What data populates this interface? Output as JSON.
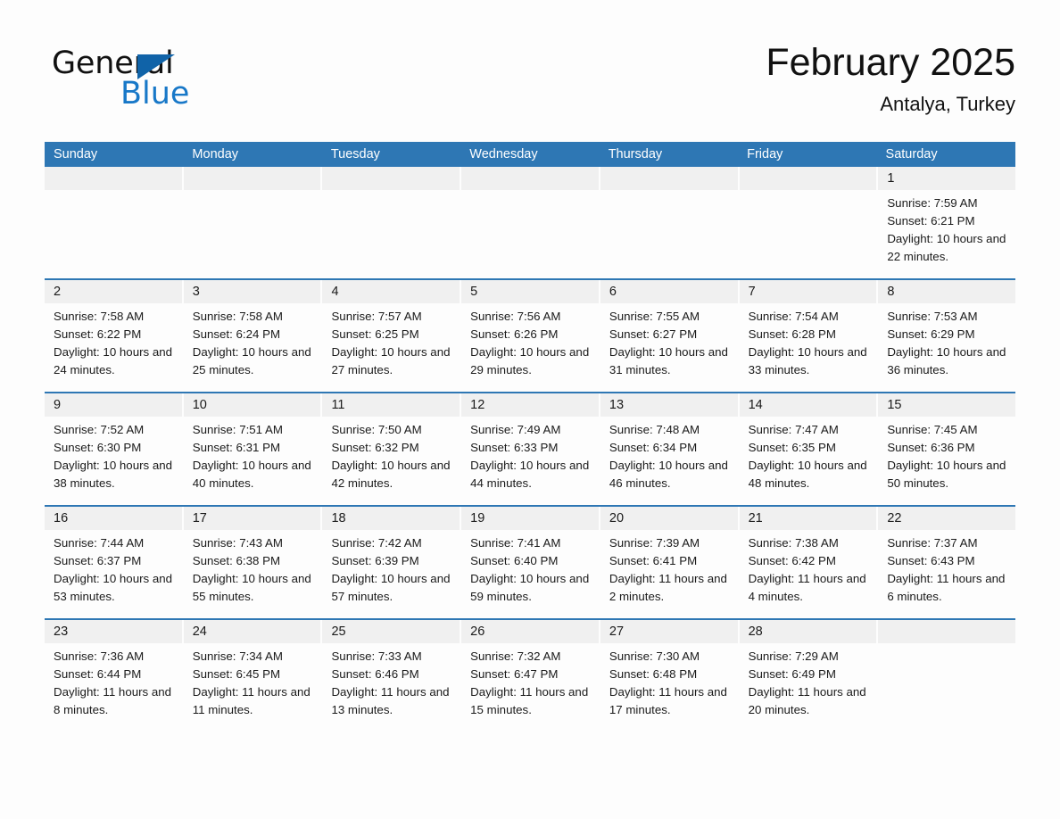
{
  "brand": {
    "name_primary": "General",
    "name_secondary": "Blue",
    "triangle_color": "#1063a8",
    "blue_color": "#1878c8"
  },
  "header": {
    "month_title": "February 2025",
    "location": "Antalya, Turkey"
  },
  "theme": {
    "header_blue": "#2e77b4",
    "day_band_gray": "#f0f0f0",
    "page_background": "#fdfdfd",
    "text_color": "#1a1a1a"
  },
  "calendar": {
    "weekdays": [
      "Sunday",
      "Monday",
      "Tuesday",
      "Wednesday",
      "Thursday",
      "Friday",
      "Saturday"
    ],
    "weeks": [
      [
        {
          "day": "",
          "sunrise": "",
          "sunset": "",
          "daylight": ""
        },
        {
          "day": "",
          "sunrise": "",
          "sunset": "",
          "daylight": ""
        },
        {
          "day": "",
          "sunrise": "",
          "sunset": "",
          "daylight": ""
        },
        {
          "day": "",
          "sunrise": "",
          "sunset": "",
          "daylight": ""
        },
        {
          "day": "",
          "sunrise": "",
          "sunset": "",
          "daylight": ""
        },
        {
          "day": "",
          "sunrise": "",
          "sunset": "",
          "daylight": ""
        },
        {
          "day": "1",
          "sunrise": "Sunrise: 7:59 AM",
          "sunset": "Sunset: 6:21 PM",
          "daylight": "Daylight: 10 hours and 22 minutes."
        }
      ],
      [
        {
          "day": "2",
          "sunrise": "Sunrise: 7:58 AM",
          "sunset": "Sunset: 6:22 PM",
          "daylight": "Daylight: 10 hours and 24 minutes."
        },
        {
          "day": "3",
          "sunrise": "Sunrise: 7:58 AM",
          "sunset": "Sunset: 6:24 PM",
          "daylight": "Daylight: 10 hours and 25 minutes."
        },
        {
          "day": "4",
          "sunrise": "Sunrise: 7:57 AM",
          "sunset": "Sunset: 6:25 PM",
          "daylight": "Daylight: 10 hours and 27 minutes."
        },
        {
          "day": "5",
          "sunrise": "Sunrise: 7:56 AM",
          "sunset": "Sunset: 6:26 PM",
          "daylight": "Daylight: 10 hours and 29 minutes."
        },
        {
          "day": "6",
          "sunrise": "Sunrise: 7:55 AM",
          "sunset": "Sunset: 6:27 PM",
          "daylight": "Daylight: 10 hours and 31 minutes."
        },
        {
          "day": "7",
          "sunrise": "Sunrise: 7:54 AM",
          "sunset": "Sunset: 6:28 PM",
          "daylight": "Daylight: 10 hours and 33 minutes."
        },
        {
          "day": "8",
          "sunrise": "Sunrise: 7:53 AM",
          "sunset": "Sunset: 6:29 PM",
          "daylight": "Daylight: 10 hours and 36 minutes."
        }
      ],
      [
        {
          "day": "9",
          "sunrise": "Sunrise: 7:52 AM",
          "sunset": "Sunset: 6:30 PM",
          "daylight": "Daylight: 10 hours and 38 minutes."
        },
        {
          "day": "10",
          "sunrise": "Sunrise: 7:51 AM",
          "sunset": "Sunset: 6:31 PM",
          "daylight": "Daylight: 10 hours and 40 minutes."
        },
        {
          "day": "11",
          "sunrise": "Sunrise: 7:50 AM",
          "sunset": "Sunset: 6:32 PM",
          "daylight": "Daylight: 10 hours and 42 minutes."
        },
        {
          "day": "12",
          "sunrise": "Sunrise: 7:49 AM",
          "sunset": "Sunset: 6:33 PM",
          "daylight": "Daylight: 10 hours and 44 minutes."
        },
        {
          "day": "13",
          "sunrise": "Sunrise: 7:48 AM",
          "sunset": "Sunset: 6:34 PM",
          "daylight": "Daylight: 10 hours and 46 minutes."
        },
        {
          "day": "14",
          "sunrise": "Sunrise: 7:47 AM",
          "sunset": "Sunset: 6:35 PM",
          "daylight": "Daylight: 10 hours and 48 minutes."
        },
        {
          "day": "15",
          "sunrise": "Sunrise: 7:45 AM",
          "sunset": "Sunset: 6:36 PM",
          "daylight": "Daylight: 10 hours and 50 minutes."
        }
      ],
      [
        {
          "day": "16",
          "sunrise": "Sunrise: 7:44 AM",
          "sunset": "Sunset: 6:37 PM",
          "daylight": "Daylight: 10 hours and 53 minutes."
        },
        {
          "day": "17",
          "sunrise": "Sunrise: 7:43 AM",
          "sunset": "Sunset: 6:38 PM",
          "daylight": "Daylight: 10 hours and 55 minutes."
        },
        {
          "day": "18",
          "sunrise": "Sunrise: 7:42 AM",
          "sunset": "Sunset: 6:39 PM",
          "daylight": "Daylight: 10 hours and 57 minutes."
        },
        {
          "day": "19",
          "sunrise": "Sunrise: 7:41 AM",
          "sunset": "Sunset: 6:40 PM",
          "daylight": "Daylight: 10 hours and 59 minutes."
        },
        {
          "day": "20",
          "sunrise": "Sunrise: 7:39 AM",
          "sunset": "Sunset: 6:41 PM",
          "daylight": "Daylight: 11 hours and 2 minutes."
        },
        {
          "day": "21",
          "sunrise": "Sunrise: 7:38 AM",
          "sunset": "Sunset: 6:42 PM",
          "daylight": "Daylight: 11 hours and 4 minutes."
        },
        {
          "day": "22",
          "sunrise": "Sunrise: 7:37 AM",
          "sunset": "Sunset: 6:43 PM",
          "daylight": "Daylight: 11 hours and 6 minutes."
        }
      ],
      [
        {
          "day": "23",
          "sunrise": "Sunrise: 7:36 AM",
          "sunset": "Sunset: 6:44 PM",
          "daylight": "Daylight: 11 hours and 8 minutes."
        },
        {
          "day": "24",
          "sunrise": "Sunrise: 7:34 AM",
          "sunset": "Sunset: 6:45 PM",
          "daylight": "Daylight: 11 hours and 11 minutes."
        },
        {
          "day": "25",
          "sunrise": "Sunrise: 7:33 AM",
          "sunset": "Sunset: 6:46 PM",
          "daylight": "Daylight: 11 hours and 13 minutes."
        },
        {
          "day": "26",
          "sunrise": "Sunrise: 7:32 AM",
          "sunset": "Sunset: 6:47 PM",
          "daylight": "Daylight: 11 hours and 15 minutes."
        },
        {
          "day": "27",
          "sunrise": "Sunrise: 7:30 AM",
          "sunset": "Sunset: 6:48 PM",
          "daylight": "Daylight: 11 hours and 17 minutes."
        },
        {
          "day": "28",
          "sunrise": "Sunrise: 7:29 AM",
          "sunset": "Sunset: 6:49 PM",
          "daylight": "Daylight: 11 hours and 20 minutes."
        },
        {
          "day": "",
          "sunrise": "",
          "sunset": "",
          "daylight": ""
        }
      ]
    ]
  }
}
